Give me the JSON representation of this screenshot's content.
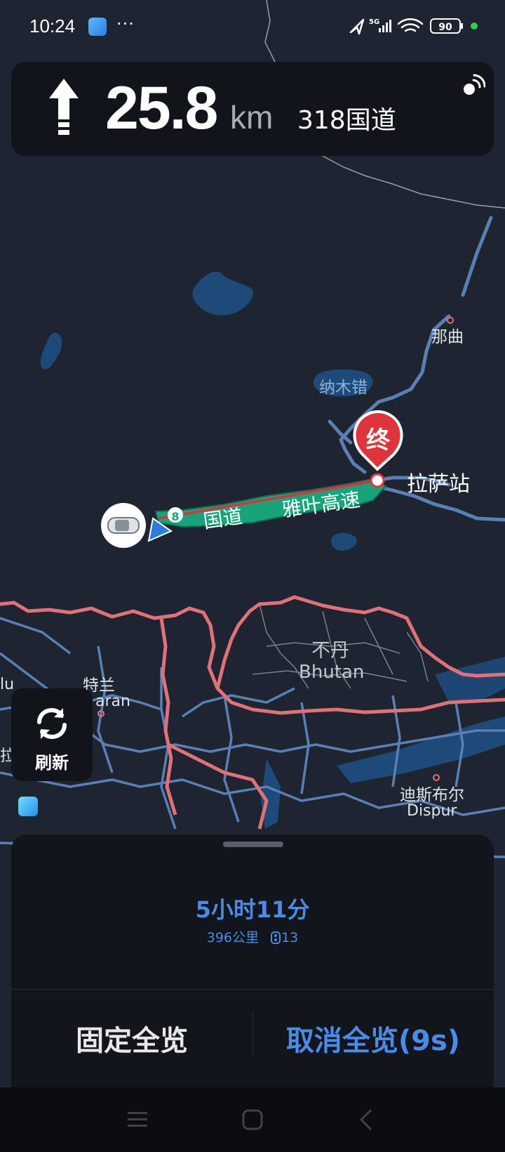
{
  "status_bar": {
    "time": "10:24",
    "more": "···",
    "network": "5G",
    "battery": "90"
  },
  "navigation": {
    "distance": "25.8",
    "unit": "km",
    "road": "318国道",
    "direction_icon": "straight-arrow-icon"
  },
  "map": {
    "labels": {
      "naqu": "那曲",
      "namtso": "纳木错",
      "lhasa_station": "拉萨站",
      "destination_marker": "终",
      "route_road_1": "国道",
      "route_road_2": "雅叶高速",
      "route_shield": "8",
      "bhutan_cn": "不丹",
      "bhutan_en": "Bhutan",
      "telan_cn": "特兰",
      "telan_en": "aran",
      "edge_lu": "lu",
      "edge_la": "拉",
      "dispur_cn": "迪斯布尔",
      "dispur_en": "Dispur"
    },
    "colors": {
      "background": "#1e2430",
      "road": "#5a7fb4",
      "border": "#e0707a",
      "water": "#1e4a7a",
      "route": "#19a37a",
      "straight_line": "#e0303a",
      "destination": "#e0343c"
    }
  },
  "refresh": {
    "label": "刷新",
    "icon": "refresh-icon"
  },
  "bottom_sheet": {
    "eta": "5小时11分",
    "distance_info": "396公里",
    "traffic_lights": "13",
    "fixed_overview_label": "固定全览",
    "cancel_overview_label": "取消全览(9s)"
  },
  "system_nav": {
    "menu_icon": "menu-icon",
    "home_icon": "home-icon",
    "back_icon": "back-icon"
  }
}
